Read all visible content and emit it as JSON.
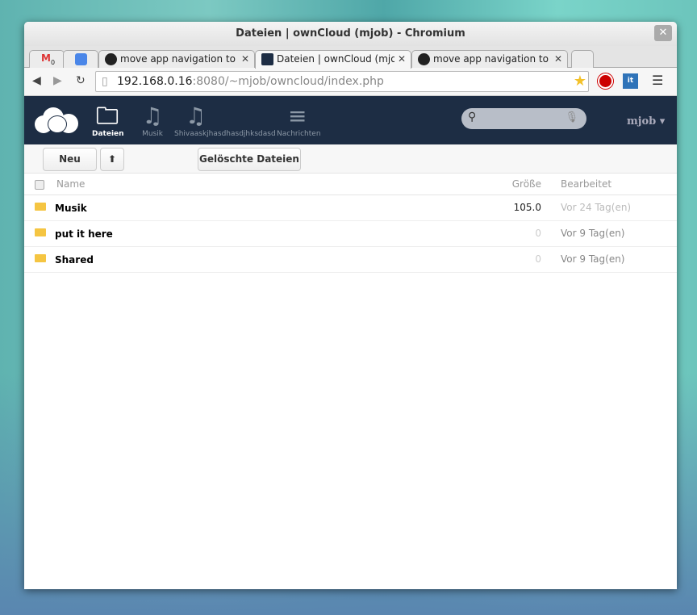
{
  "window": {
    "title": "Dateien | ownCloud (mjob) - Chromium"
  },
  "tabs": [
    {
      "label": "",
      "icon": "gmail-icon",
      "badge": "0"
    },
    {
      "label": "",
      "icon": "owncloud-app-icon"
    },
    {
      "label": "move app navigation to to",
      "icon": "github-icon"
    },
    {
      "label": "Dateien | ownCloud (mjob)",
      "icon": "owncloud-icon",
      "active": true
    },
    {
      "label": "move app navigation to to",
      "icon": "github-icon"
    }
  ],
  "address": {
    "host": "192.168.0.16",
    "rest": ":8080/~mjob/owncloud/index.php"
  },
  "extensions": {
    "it_label": "it"
  },
  "nav": [
    {
      "label": "Dateien",
      "icon": "folder-icon",
      "active": true
    },
    {
      "label": "Musik",
      "icon": "music-icon"
    },
    {
      "label": "Shivaaskjhasdhasdjhksdasd",
      "icon": "music-icon"
    },
    {
      "label": "Nachrichten",
      "icon": "news-icon"
    }
  ],
  "user": "mjob ▾",
  "controls": {
    "new": "Neu",
    "upload": "⬆",
    "deleted": "Gelöschte Dateien"
  },
  "table": {
    "headers": {
      "name": "Name",
      "size": "Größe",
      "modified": "Bearbeitet"
    },
    "rows": [
      {
        "name": "Musik",
        "size": "105.0",
        "modified": "Vor 24 Tag(en)"
      },
      {
        "name": "put it here",
        "size": "0",
        "modified": "Vor 9 Tag(en)"
      },
      {
        "name": "Shared",
        "size": "0",
        "modified": "Vor 9 Tag(en)"
      }
    ]
  }
}
